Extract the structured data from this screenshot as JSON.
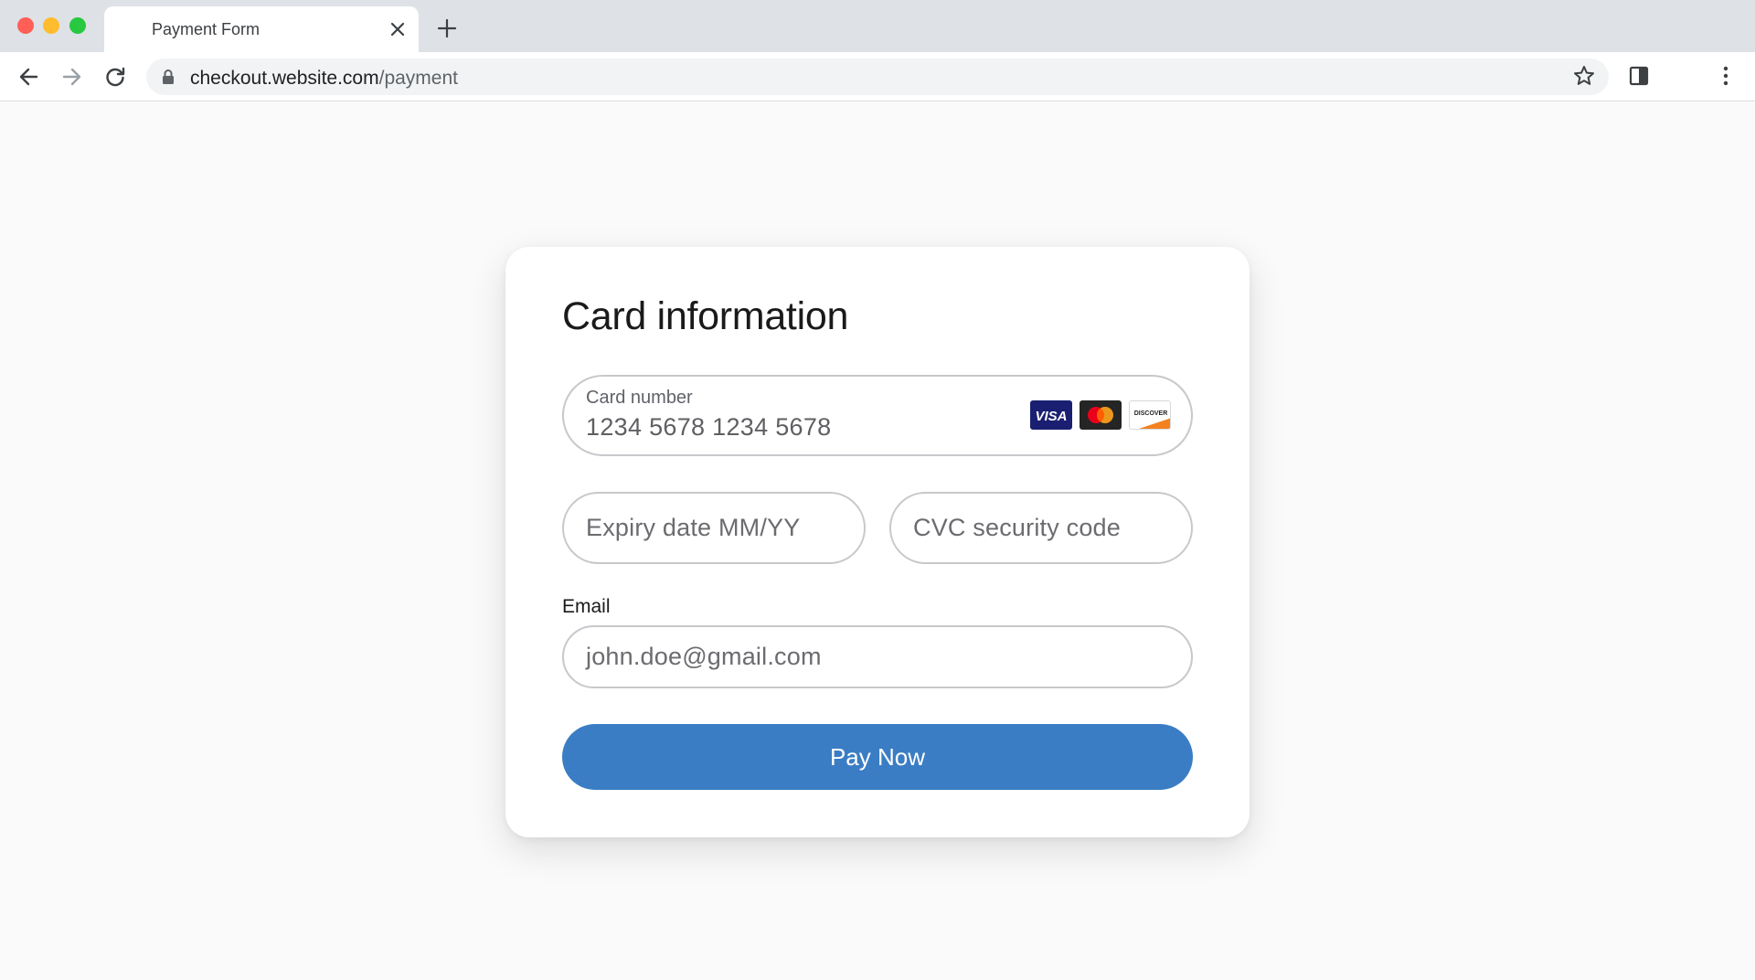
{
  "browser": {
    "tab": {
      "title": "Payment Form"
    },
    "address_bar": {
      "host": "checkout.website.com",
      "path": "/payment"
    },
    "icons": {
      "back": "arrow-left-icon",
      "forward": "arrow-right-icon",
      "reload": "reload-icon",
      "lock": "lock-icon",
      "bookmark": "star-icon",
      "side_panel": "side-panel-icon",
      "menu": "kebab-menu-icon",
      "close_tab": "close-icon",
      "new_tab": "plus-icon"
    },
    "window_controls": {
      "close_color": "#ff5f57",
      "minimize_color": "#febc2e",
      "maximize_color": "#28c840"
    }
  },
  "form": {
    "title": "Card information",
    "card_number": {
      "label": "Card number",
      "value": "1234 5678 1234 5678"
    },
    "card_brands": [
      {
        "name": "VISA",
        "icon": "visa-logo-icon"
      },
      {
        "name": "Mastercard",
        "icon": "mastercard-logo-icon"
      },
      {
        "name": "DISCOVER",
        "icon": "discover-logo-icon"
      }
    ],
    "expiry": {
      "placeholder": "Expiry date MM/YY"
    },
    "cvc": {
      "placeholder": "CVC security code"
    },
    "email": {
      "label": "Email",
      "placeholder": "john.doe@gmail.com"
    },
    "submit": {
      "label": "Pay Now"
    }
  },
  "colors": {
    "accent": "#3a7dc4",
    "page_background": "#fafafa",
    "card_background": "#ffffff",
    "field_border": "#c8c8cc"
  }
}
